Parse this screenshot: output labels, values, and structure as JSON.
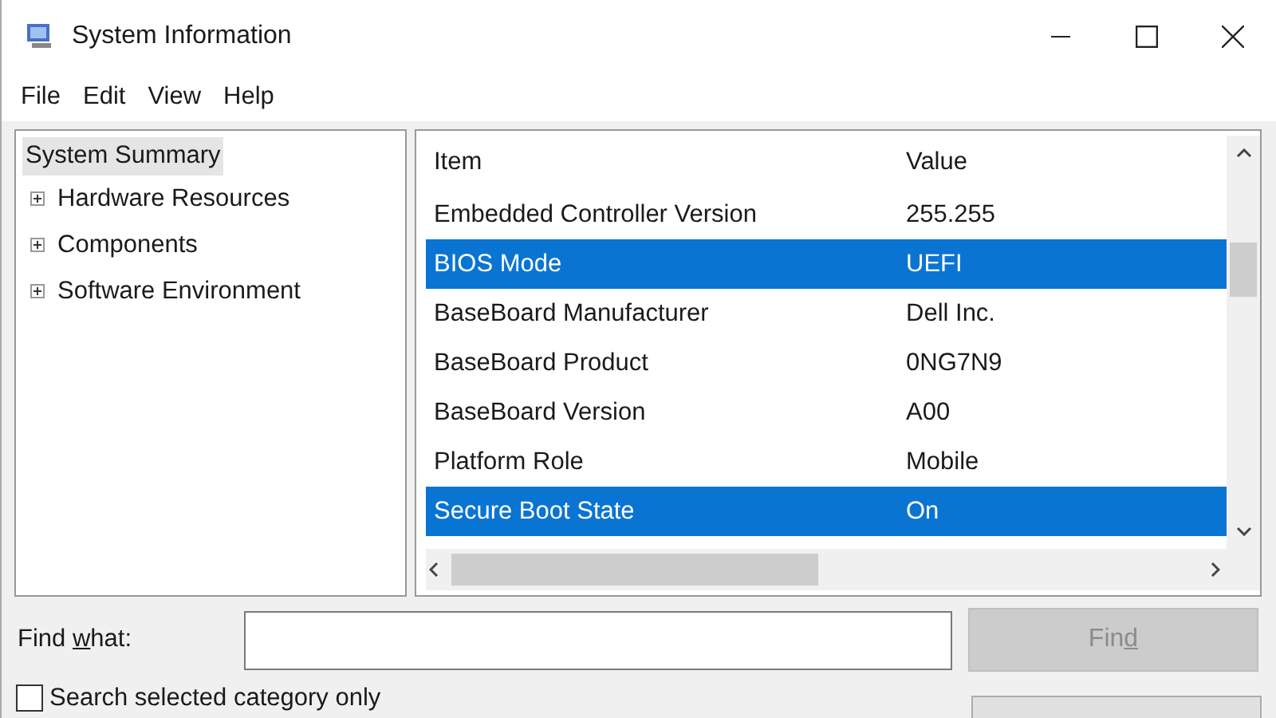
{
  "window": {
    "title": "System Information"
  },
  "menu": [
    "File",
    "Edit",
    "View",
    "Help"
  ],
  "tree": {
    "label": "System Summary",
    "selected": true,
    "children": [
      {
        "label": "Hardware Resources",
        "selected": false,
        "expanded": false
      },
      {
        "label": "Components",
        "selected": false,
        "expanded": false
      },
      {
        "label": "Software Environment",
        "selected": false,
        "expanded": false
      }
    ]
  },
  "table": {
    "columns": [
      "Item",
      "Value"
    ],
    "rows": [
      {
        "item": "Embedded Controller Version",
        "value": "255.255",
        "selected": false
      },
      {
        "item": "BIOS Mode",
        "value": "UEFI",
        "selected": true
      },
      {
        "item": "BaseBoard Manufacturer",
        "value": "Dell Inc.",
        "selected": false
      },
      {
        "item": "BaseBoard Product",
        "value": "0NG7N9",
        "selected": false
      },
      {
        "item": "BaseBoard Version",
        "value": "A00",
        "selected": false
      },
      {
        "item": "Platform Role",
        "value": "Mobile",
        "selected": false
      },
      {
        "item": "Secure Boot State",
        "value": "On",
        "selected": true
      }
    ]
  },
  "find": {
    "label_before": "Find ",
    "access_key": "w",
    "label_after": "hat:",
    "button": {
      "label_before": "Fin",
      "access_key": "d",
      "disabled": true
    }
  },
  "search_selected_category_only": {
    "label": "Search selected category only",
    "checked": false
  }
}
